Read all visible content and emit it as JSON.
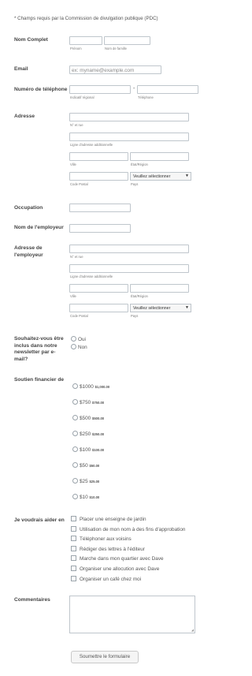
{
  "required_note": "* Champs requis par la Commission de divulgation publique (PDC)",
  "name": {
    "label": "Nom Complet",
    "first_sub": "Prénom",
    "last_sub": "Nom de famille"
  },
  "email": {
    "label": "Email",
    "placeholder": "ex: myname@example.com"
  },
  "phone": {
    "label": "Numéro de téléphone",
    "area_sub": "Indicatif régional",
    "number_sub": "Téléphone",
    "separator": "-"
  },
  "address": {
    "label": "Adresse",
    "street_sub": "N° et rue",
    "line2_sub": "Ligne d'adresse additionnelle",
    "city_sub": "Ville",
    "state_sub": "État/Région",
    "postal_sub": "Code Postal",
    "country_sub": "Pays",
    "country_value": "Veuillez sélectionner"
  },
  "occupation": {
    "label": "Occupation"
  },
  "employer": {
    "label": "Nom de l'employeur"
  },
  "employer_address": {
    "label": "Adresse de l'employeur",
    "street_sub": "N° et rue",
    "line2_sub": "Ligne d'adresse additionnelle",
    "city_sub": "Ville",
    "state_sub": "État/Région",
    "postal_sub": "Code Postal",
    "country_sub": "Pays",
    "country_value": "Veuillez sélectionner"
  },
  "newsletter": {
    "label": "Souhaitez-vous être inclus dans notre newsletter par e-mail?",
    "options": [
      "Oui",
      "Non"
    ]
  },
  "support": {
    "label": "Soutien financier de",
    "options": [
      {
        "main": "$1000",
        "amount": "$1,000.00"
      },
      {
        "main": "$750",
        "amount": "$750.00"
      },
      {
        "main": "$500",
        "amount": "$500.00"
      },
      {
        "main": "$250",
        "amount": "$250.00"
      },
      {
        "main": "$100",
        "amount": "$100.00"
      },
      {
        "main": "$50",
        "amount": "$50.00"
      },
      {
        "main": "$25",
        "amount": "$25.00"
      },
      {
        "main": "$10",
        "amount": "$10.00"
      }
    ]
  },
  "help": {
    "label": "Je voudrais aider en",
    "options": [
      "Placer une enseigne de jardin",
      "Utilisation de mon nom à des fins d'approbation",
      "Téléphoner aux voisins",
      "Rédiger des lettres à l'éditeur",
      "Marche dans mon quartier avec Dave",
      "Organiser une allocution avec Dave",
      "Organiser un café chez moi"
    ]
  },
  "comments": {
    "label": "Commentaires"
  },
  "submit": {
    "label": "Soumettre le formulaire"
  }
}
